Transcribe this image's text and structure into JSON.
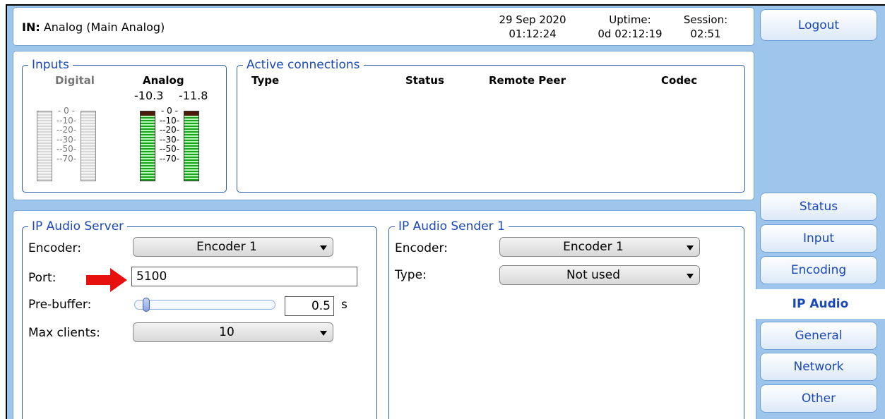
{
  "header": {
    "in_label": "IN:",
    "in_value": "Analog (Main Analog)",
    "date": "29 Sep 2020",
    "time": "01:12:24",
    "uptime_label": "Uptime:",
    "uptime_value": "0d 02:12:19",
    "session_label": "Session:",
    "session_value": "02:51"
  },
  "nav": {
    "logout": "Logout",
    "items": [
      "Status",
      "Input",
      "Encoding",
      "IP Audio",
      "General",
      "Network",
      "Other"
    ],
    "active": "IP Audio"
  },
  "inputs": {
    "title": "Inputs",
    "digital_label": "Digital",
    "analog_label": "Analog",
    "analog_left_db": "-10.3",
    "analog_right_db": "-11.8",
    "scale": [
      "0",
      "-10",
      "-20",
      "-30",
      "-50",
      "-70"
    ]
  },
  "connections": {
    "title": "Active connections",
    "columns": [
      "Type",
      "Status",
      "Remote Peer",
      "Codec"
    ]
  },
  "server": {
    "title": "IP Audio Server",
    "encoder_label": "Encoder:",
    "encoder_value": "Encoder 1",
    "port_label": "Port:",
    "port_value": "5100",
    "prebuffer_label": "Pre-buffer:",
    "prebuffer_value": "0.5",
    "prebuffer_unit": "s",
    "prebuffer_fraction": 0.0,
    "maxclients_label": "Max clients:",
    "maxclients_value": "10"
  },
  "sender": {
    "title": "IP Audio Sender 1",
    "encoder_label": "Encoder:",
    "encoder_value": "Encoder 1",
    "type_label": "Type:",
    "type_value": "Not used"
  },
  "colors": {
    "frame": "#9ec6ec",
    "accent": "#1a48b8",
    "arrow": "#e8100f"
  }
}
